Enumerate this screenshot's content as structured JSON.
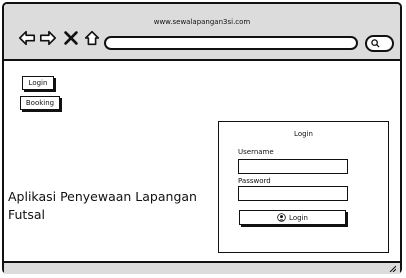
{
  "browser": {
    "url": "www.sewalapangan3si.com"
  },
  "nav": {
    "back_icon": "back-arrow-icon",
    "forward_icon": "forward-arrow-icon",
    "close_icon": "close-x-icon",
    "home_icon": "home-icon"
  },
  "sidebar": {
    "login_label": "Login",
    "booking_label": "Booking"
  },
  "main": {
    "title": "Aplikasi Penyewaan Lapangan Futsal"
  },
  "login_form": {
    "title": "Login",
    "username_label": "Username",
    "password_label": "Password",
    "username_value": "",
    "password_value": "",
    "submit_label": "Login"
  }
}
